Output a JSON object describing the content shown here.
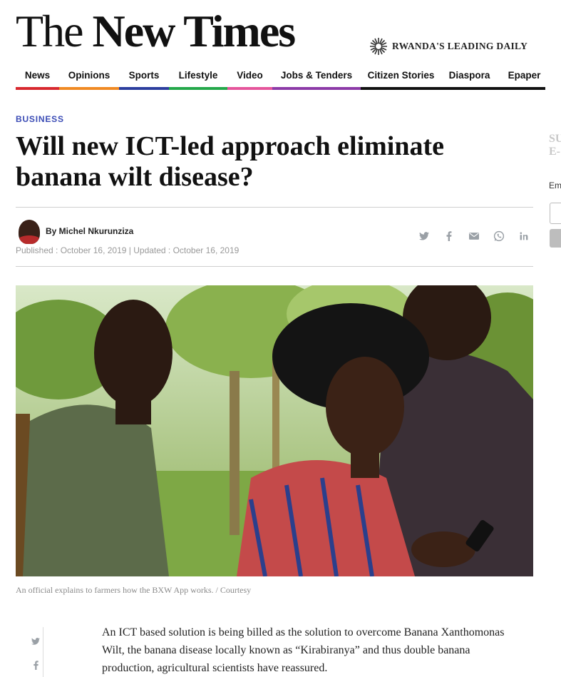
{
  "masthead": {
    "logo_part1": "The",
    "logo_part2": "New Times",
    "tagline": "RWANDA'S LEADING DAILY"
  },
  "nav": {
    "items": [
      {
        "label": "News",
        "color": "#d8292f"
      },
      {
        "label": "Opinions",
        "color": "#f08a23"
      },
      {
        "label": "Sports",
        "color": "#2c3e9e"
      },
      {
        "label": "Lifestyle",
        "color": "#24a84a"
      },
      {
        "label": "Video",
        "color": "#e5559b"
      },
      {
        "label": "Jobs & Tenders",
        "color": "#8c3aa8"
      },
      {
        "label": "Citizen Stories",
        "color": "#111111"
      },
      {
        "label": "Diaspora",
        "color": "#111111"
      },
      {
        "label": "Epaper",
        "color": "#111111"
      }
    ]
  },
  "article": {
    "category": "BUSINESS",
    "title": "Will new ICT-led approach eliminate banana wilt disease?",
    "byline": "By Michel Nkurunziza",
    "dates": "Published : October 16, 2019 | Updated : October 16, 2019",
    "caption": "An official explains to farmers how the BXW App works. / Courtesy",
    "lede": "An ICT based solution is being billed as the solution to overcome Banana Xanthomonas Wilt, the banana disease locally known as “Kirabiranya” and thus double banana production, agricultural scientists have reassured."
  },
  "share_icons": [
    "twitter-icon",
    "facebook-icon",
    "email-icon",
    "whatsapp-icon",
    "linkedin-icon"
  ],
  "sidebar": {
    "heading_line1": "SU",
    "heading_line2": "E-",
    "email_label": "Em"
  }
}
